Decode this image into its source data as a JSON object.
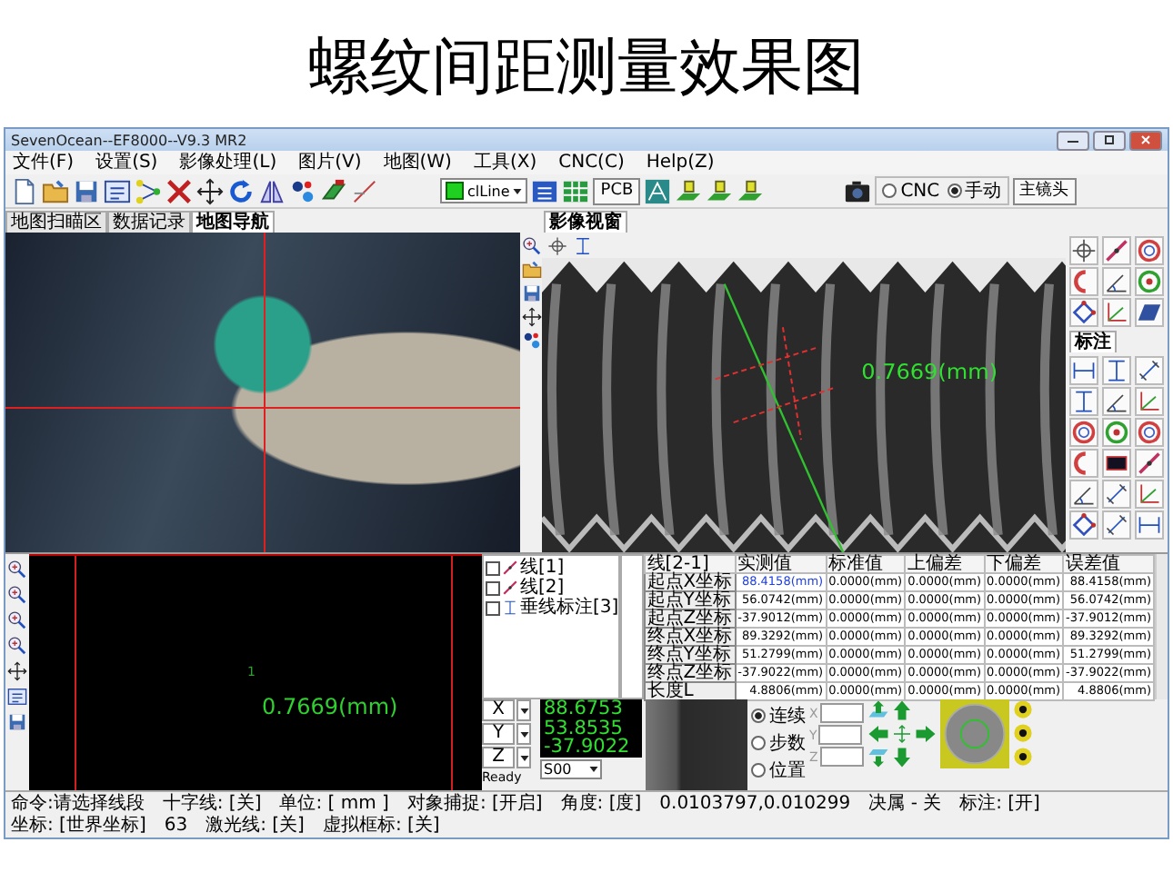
{
  "page_title": "螺纹间距测量效果图",
  "window": {
    "title": "SevenOcean--EF8000--V9.3 MR2"
  },
  "menu": [
    "文件(F)",
    "设置(S)",
    "影像处理(L)",
    "图片(V)",
    "地图(W)",
    "工具(X)",
    "CNC(C)",
    "Help(Z)"
  ],
  "toolbar": {
    "line_style": "clLine",
    "pcb_button": "PCB",
    "mode_options": [
      {
        "label": "CNC",
        "selected": false
      },
      {
        "label": "手动",
        "selected": true
      }
    ],
    "lens_button": "主镜头"
  },
  "left_tabs": [
    {
      "label": "地图扫瞄区",
      "selected": false
    },
    {
      "label": "数据记录",
      "selected": false
    },
    {
      "label": "地图导航",
      "selected": true
    }
  ],
  "right_tabs": [
    {
      "label": "影像视窗",
      "selected": true
    }
  ],
  "image_view": {
    "measurement": "0.7669(mm)"
  },
  "palette": {
    "tabs": [
      {
        "label": "标注",
        "selected": true
      }
    ]
  },
  "canvas": {
    "marker": "1",
    "measurement": "0.7669(mm)"
  },
  "objects": [
    {
      "label": "线[1]",
      "checked": false,
      "kind": "line"
    },
    {
      "label": "线[2]",
      "checked": false,
      "kind": "line"
    },
    {
      "label": "垂线标注[3]",
      "checked": false,
      "kind": "perpendicular"
    }
  ],
  "table": {
    "columns": [
      "线[2-1]",
      "实测值",
      "标准值",
      "上偏差",
      "下偏差",
      "误差值"
    ],
    "rows": [
      {
        "cells": [
          "起点X坐标",
          "88.4158(mm)",
          "0.0000(mm)",
          "0.0000(mm)",
          "0.0000(mm)",
          "88.4158(mm)"
        ],
        "selected": true
      },
      {
        "cells": [
          "起点Y坐标",
          "56.0742(mm)",
          "0.0000(mm)",
          "0.0000(mm)",
          "0.0000(mm)",
          "56.0742(mm)"
        ],
        "selected": false
      },
      {
        "cells": [
          "起点Z坐标",
          "-37.9012(mm)",
          "0.0000(mm)",
          "0.0000(mm)",
          "0.0000(mm)",
          "-37.9012(mm)"
        ],
        "selected": false
      },
      {
        "cells": [
          "终点X坐标",
          "89.3292(mm)",
          "0.0000(mm)",
          "0.0000(mm)",
          "0.0000(mm)",
          "89.3292(mm)"
        ],
        "selected": false
      },
      {
        "cells": [
          "终点Y坐标",
          "51.2799(mm)",
          "0.0000(mm)",
          "0.0000(mm)",
          "0.0000(mm)",
          "51.2799(mm)"
        ],
        "selected": false
      },
      {
        "cells": [
          "终点Z坐标",
          "-37.9022(mm)",
          "0.0000(mm)",
          "0.0000(mm)",
          "0.0000(mm)",
          "-37.9022(mm)"
        ],
        "selected": false
      },
      {
        "cells": [
          "长度L",
          "4.8806(mm)",
          "0.0000(mm)",
          "0.0000(mm)",
          "0.0000(mm)",
          "4.8806(mm)"
        ],
        "selected": false
      }
    ]
  },
  "dro": {
    "axes": [
      {
        "label": "X",
        "value": "88.6753"
      },
      {
        "label": "Y",
        "value": "53.8535"
      },
      {
        "label": "Z",
        "value": "-37.9022"
      }
    ],
    "status": "Ready",
    "program": "S00"
  },
  "jog": {
    "modes": [
      {
        "label": "连续",
        "selected": true
      },
      {
        "label": "步数",
        "selected": false
      },
      {
        "label": "位置",
        "selected": false
      }
    ],
    "fields": [
      {
        "label": "X"
      },
      {
        "label": "Y"
      },
      {
        "label": "Z"
      }
    ]
  },
  "status_bar": [
    "命令:请选择线段",
    "十字线: [关]",
    "单位: [ mm ]",
    "对象捕捉: [开启]",
    "角度: [度]",
    "0.0103797,0.010299",
    "决属 - 关",
    "标注: [开]",
    "坐标: [世界坐标]",
    "63",
    "激光线: [关]",
    "虚拟框标: [关]"
  ]
}
